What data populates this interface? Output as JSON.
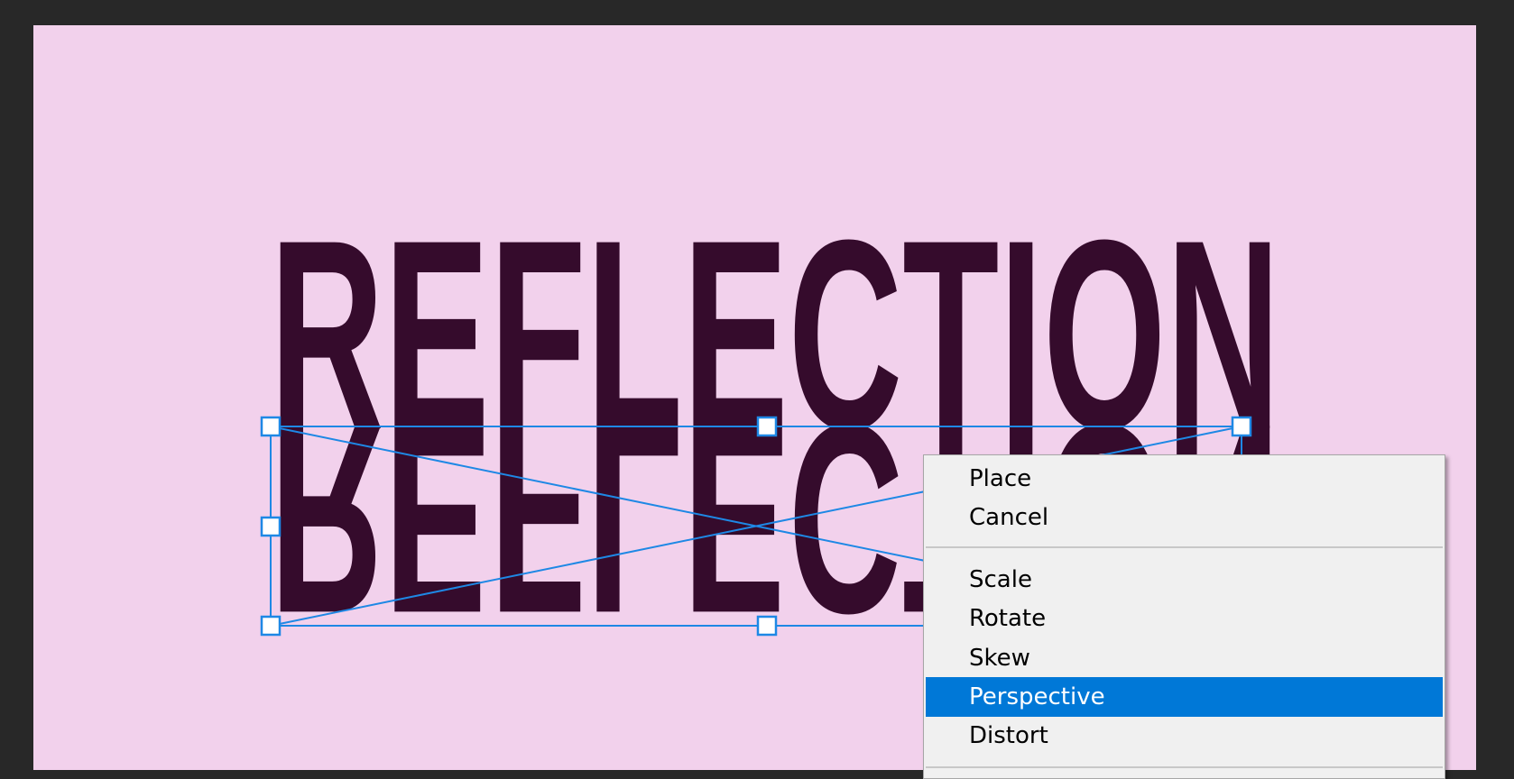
{
  "canvas": {
    "background": "#f2d1ec",
    "text_color": "#350b2c",
    "transform_color": "#1e88e5"
  },
  "artwork": {
    "top_text": "REFLECTION",
    "reflected_text": "REFLECTION"
  },
  "context_menu": {
    "items": [
      {
        "label": "Place"
      },
      {
        "label": "Cancel"
      },
      {
        "label": "Scale"
      },
      {
        "label": "Rotate"
      },
      {
        "label": "Skew"
      },
      {
        "label": "Perspective",
        "selected": true
      },
      {
        "label": "Distort"
      }
    ],
    "highlight_color": "#0078d7"
  }
}
